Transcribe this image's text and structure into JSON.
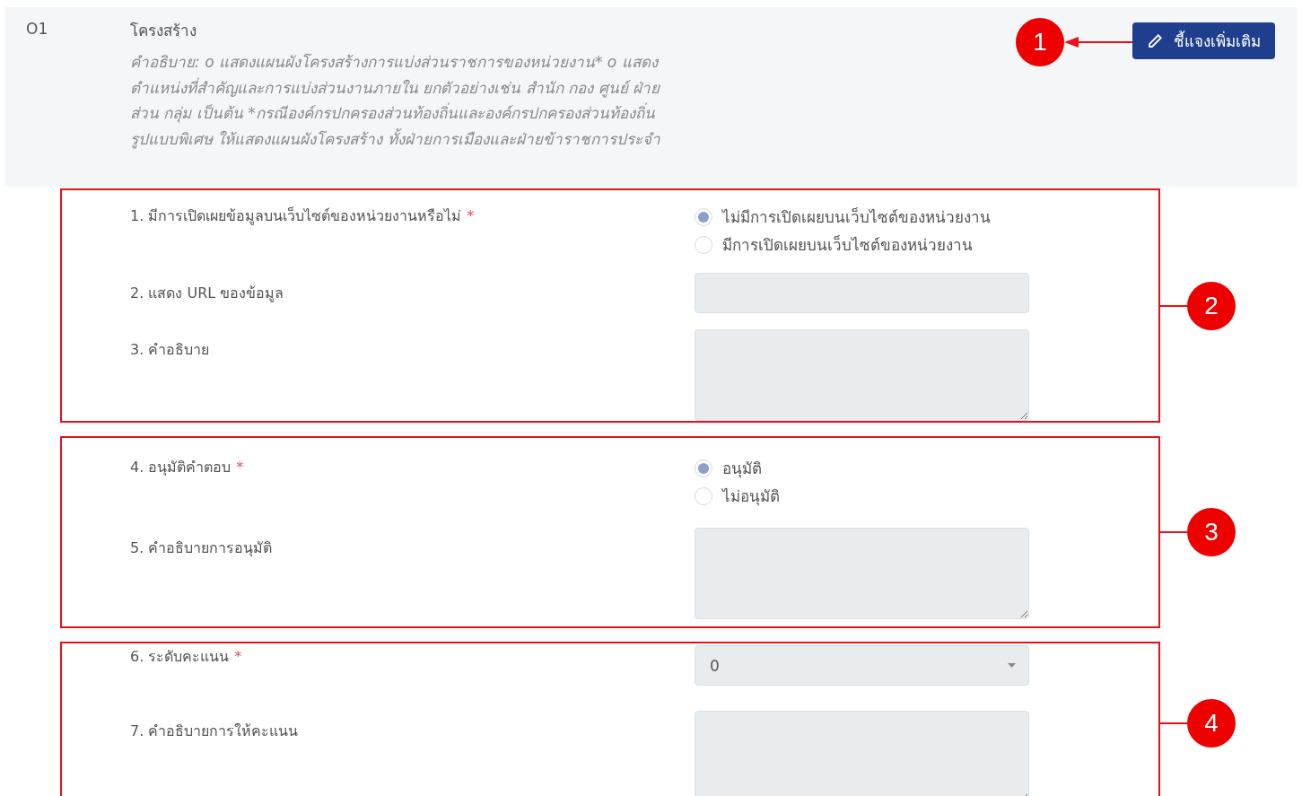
{
  "header": {
    "code": "O1",
    "title": "โครงสร้าง",
    "description": "คำอธิบาย: o แสดงแผนผังโครงสร้างการแบ่งส่วนราชการของหน่วยงาน* o แสดงตำแหน่งที่สำคัญและการแบ่งส่วนงานภายใน ยกตัวอย่างเช่น สำนัก กอง ศูนย์ ฝ่าย ส่วน กลุ่ม เป็นต้น *กรณีองค์กรปกครองส่วนท้องถิ่นและองค์กรปกครองส่วนท้องถิ่นรูปแบบพิเศษ ให้แสดงแผนผังโครงสร้าง ทั้งฝ่ายการเมืองและฝ่ายข้าราชการประจำ",
    "button": "ชี้แจงเพิ่มเติม",
    "annotation": "1"
  },
  "sections": [
    {
      "annotation": "2",
      "fields": [
        {
          "kind": "radio",
          "label": "1. มีการเปิดเผยข้อมูลบนเว็บไซต์ของหน่วยงานหรือไม่",
          "required_mark": "*",
          "options": [
            {
              "label": "ไม่มีการเปิดเผยบนเว็บไซต์ของหน่วยงาน",
              "selected": true
            },
            {
              "label": "มีการเปิดเผยบนเว็บไซต์ของหน่วยงาน",
              "selected": false
            }
          ]
        },
        {
          "kind": "input",
          "label": "2. แสดง URL ของข้อมูล"
        },
        {
          "kind": "textarea",
          "label": "3. คำอธิบาย"
        }
      ]
    },
    {
      "annotation": "3",
      "fields": [
        {
          "kind": "radio",
          "label": "4. อนุมัติคำตอบ",
          "required_mark": "*",
          "options": [
            {
              "label": "อนุมัติ",
              "selected": true
            },
            {
              "label": "ไม่อนุมัติ",
              "selected": false
            }
          ]
        },
        {
          "kind": "textarea",
          "label": "5. คำอธิบายการอนุมัติ"
        }
      ]
    },
    {
      "annotation": "4",
      "fields": [
        {
          "kind": "select",
          "label": "6. ระดับคะแนน",
          "required_mark": "*",
          "value": "0"
        },
        {
          "kind": "textarea",
          "label": "7. คำอธิบายการให้คะแนน"
        }
      ]
    }
  ]
}
